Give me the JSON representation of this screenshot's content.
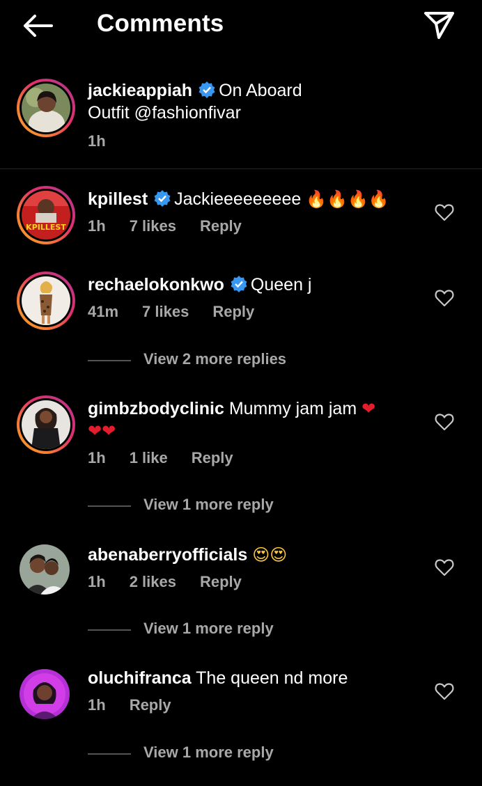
{
  "header": {
    "title": "Comments"
  },
  "caption": {
    "username": "jackieappiah",
    "text_line1": "On Aboard",
    "text_line2": "Outfit @fashionfivar",
    "time": "1h"
  },
  "comments": [
    {
      "username": "kpillest",
      "text": "Jackieeeeeeeee",
      "emoji": "🔥🔥🔥🔥",
      "time": "1h",
      "likes": "7 likes",
      "reply": "Reply"
    },
    {
      "username": "rechaelokonkwo",
      "text": "Queen j",
      "time": "41m",
      "likes": "7 likes",
      "reply": "Reply",
      "view_replies": "View 2 more replies"
    },
    {
      "username": "gimbzbodyclinic",
      "text": "Mummy jam jam",
      "emoji": "❤",
      "emoji_line2": "❤❤",
      "time": "1h",
      "likes": "1 like",
      "reply": "Reply",
      "view_replies": "View 1 more reply"
    },
    {
      "username": "abenaberryofficials",
      "emoji": "😍😍",
      "time": "1h",
      "likes": "2 likes",
      "reply": "Reply",
      "view_replies": "View 1 more reply"
    },
    {
      "username": "oluchifranca",
      "text": "The queen nd more",
      "time": "1h",
      "reply": "Reply",
      "view_replies": "View 1 more reply"
    }
  ],
  "avatar_logo_text": "KPILLEST",
  "colors": {
    "background": "#000000",
    "secondary_text": "#a8a8a8",
    "verified": "#3897f0"
  }
}
